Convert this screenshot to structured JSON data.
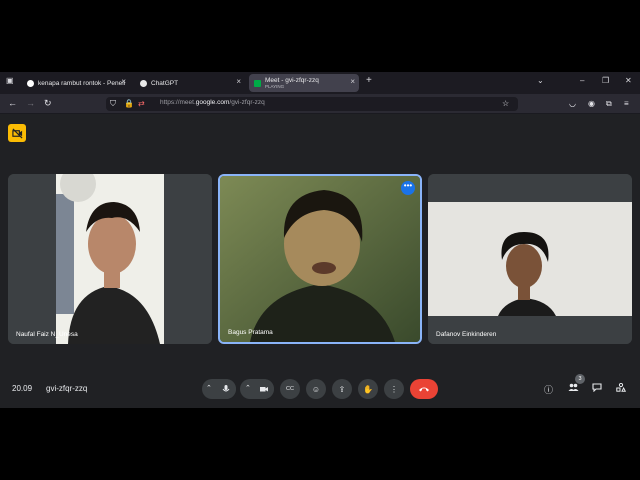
{
  "browser": {
    "tabs": [
      {
        "title": "kenapa rambut rontok - Peneli",
        "close": "×"
      },
      {
        "title": "ChatGPT",
        "close": "×"
      },
      {
        "title": "Meet - gvi-zfqr-zzq",
        "status": "PLAYING",
        "close": "×"
      }
    ],
    "new_tab": "+",
    "url_prefix": "https://meet.",
    "url_domain": "google.com",
    "url_path": "/gvi-zfqr-zzq"
  },
  "meet": {
    "participants": [
      {
        "name": "Naufal Faiz N_Unesa"
      },
      {
        "name": "Bagus Pratama"
      },
      {
        "name": "Dafanov Einkinderen"
      }
    ],
    "clock": "20.09",
    "meeting_code": "gvi-zfqr-zzq",
    "people_count": "3"
  },
  "icons": {
    "host_badge": "camera-off-icon",
    "more": "•••",
    "mic": "🎤",
    "camera": "▭",
    "captions": "CC",
    "emoji": "☺",
    "present": "⇪",
    "hand": "✋",
    "options": "⋮",
    "leave": "☎",
    "info": "ⓘ",
    "people": "👥",
    "chat": "💬",
    "activities": "⚙"
  },
  "colors": {
    "accent": "#8ab4f8",
    "leave": "#ea4335",
    "badge": "#fbbc04"
  }
}
